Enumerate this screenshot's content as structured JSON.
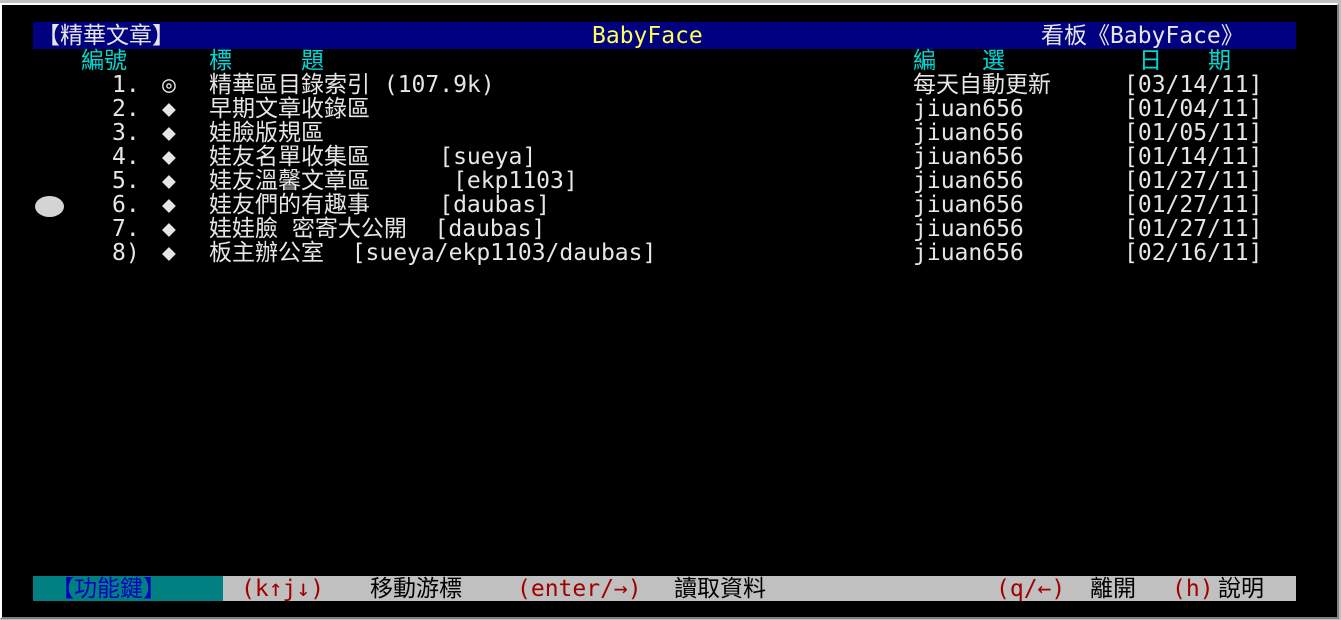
{
  "header": {
    "section": "【精華文章】",
    "board_name": "BabyFace",
    "board_label": "看板《BabyFace》"
  },
  "columns": {
    "number": "編號",
    "title": "標　　　題",
    "editor": "編　　選",
    "date": "日　　期"
  },
  "items": [
    {
      "number": "1.",
      "icon": "◎",
      "title": "精華區目錄索引 (107.9k)",
      "editor": "每天自動更新",
      "date": "[03/14/11]"
    },
    {
      "number": "2.",
      "icon": "◆",
      "title": "早期文章收錄區",
      "editor": "jiuan656",
      "date": "[01/04/11]"
    },
    {
      "number": "3.",
      "icon": "◆",
      "title": "娃臉版規區",
      "editor": "jiuan656",
      "date": "[01/05/11]"
    },
    {
      "number": "4.",
      "icon": "◆",
      "title": "娃友名單收集區     [sueya]",
      "editor": "jiuan656",
      "date": "[01/14/11]"
    },
    {
      "number": "5.",
      "icon": "◆",
      "title": "娃友溫馨文章區      [ekp1103]",
      "editor": "jiuan656",
      "date": "[01/27/11]"
    },
    {
      "number": "6.",
      "icon": "◆",
      "title": "娃友們的有趣事     [daubas]",
      "editor": "jiuan656",
      "date": "[01/27/11]"
    },
    {
      "number": "7.",
      "icon": "◆",
      "title": "娃娃臉 密寄大公開  [daubas]",
      "editor": "jiuan656",
      "date": "[01/27/11]"
    },
    {
      "number": "8)",
      "icon": "◆",
      "title": "板主辦公室  [sueya/ekp1103/daubas]",
      "editor": "jiuan656",
      "date": "[02/16/11]"
    }
  ],
  "footer": {
    "function_keys": "【功能鍵】",
    "k1": "(k↑j↓)",
    "a1": "移動游標",
    "k2": "(enter/→)",
    "a2": "讀取資料",
    "k3": "(q/←)",
    "a3": "離開",
    "k4": "(h)",
    "a4": "說明"
  },
  "colors": {
    "title_bar": "#000080",
    "highlight_text": "#ffff55",
    "column_header": "#00d8d8",
    "footer_bg": "#c0c0c0",
    "footer_key_bg": "#008080",
    "footer_key_text": "#a00000"
  }
}
